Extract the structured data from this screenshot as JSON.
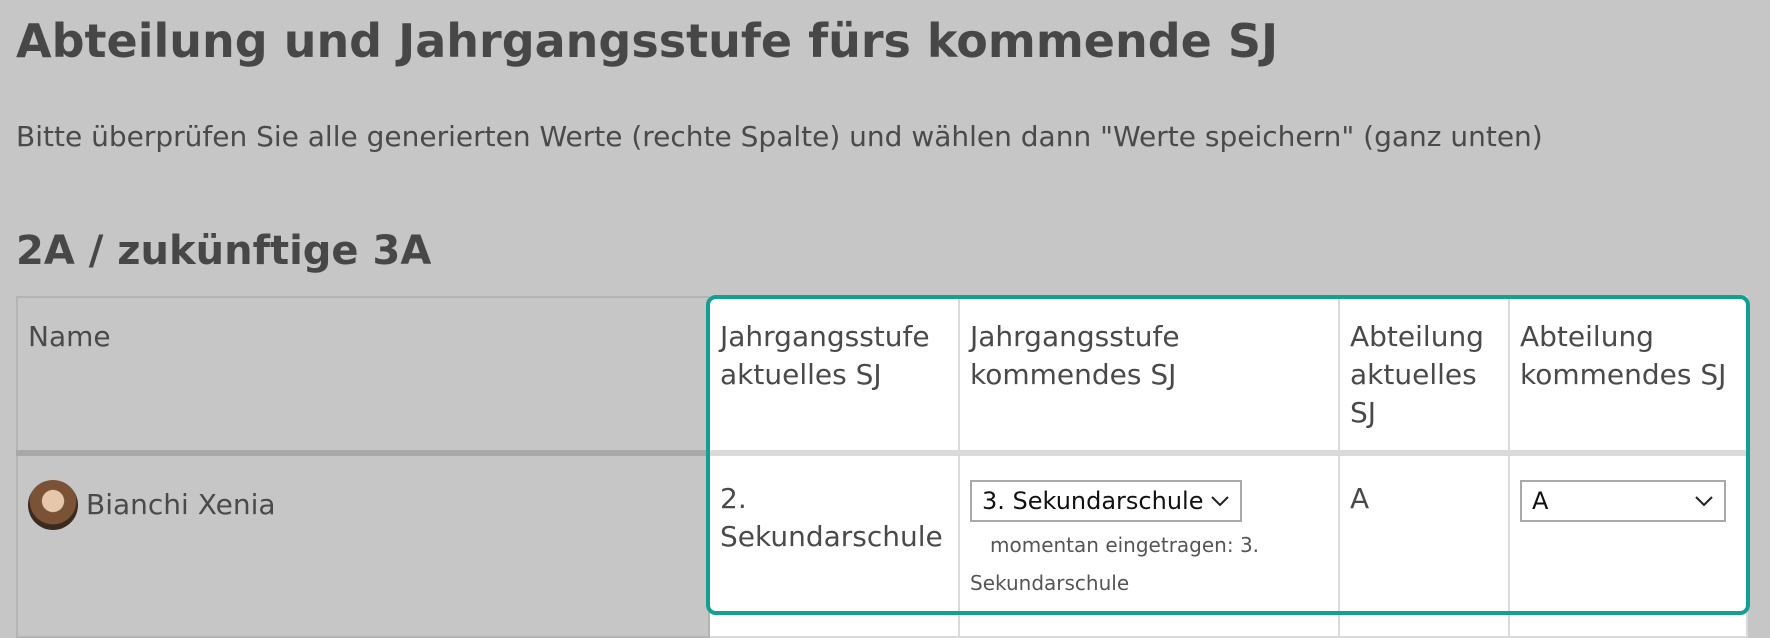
{
  "page": {
    "title": "Abteilung und Jahrgangsstufe fürs kommende SJ",
    "intro": "Bitte überprüfen Sie alle generierten Werte (rechte Spalte) und wählen dann \"Werte speichern\" (ganz unten)",
    "section_title": "2A / zukünftige 3A"
  },
  "table": {
    "headers": {
      "name": "Name",
      "grade_current": "Jahrgangsstufe aktuelles SJ",
      "grade_next": "Jahrgangsstufe kommendes SJ",
      "dept_current": "Abteilung aktuelles SJ",
      "dept_next": "Abteilung kommendes SJ"
    },
    "rows": [
      {
        "name": "Bianchi Xenia",
        "grade_current": "2. Sekundarschule",
        "grade_next_selected": "3. Sekundarschule",
        "note_prefix": "momentan eingetragen: 3.",
        "note_suffix": "Sekundarschule",
        "dept_current": "A",
        "dept_next_selected": "A"
      }
    ]
  },
  "colors": {
    "background": "#c6c6c6",
    "highlight": "#13a090",
    "panel": "#ffffff"
  },
  "icons": {
    "dropdown": "chevron-down-icon"
  }
}
